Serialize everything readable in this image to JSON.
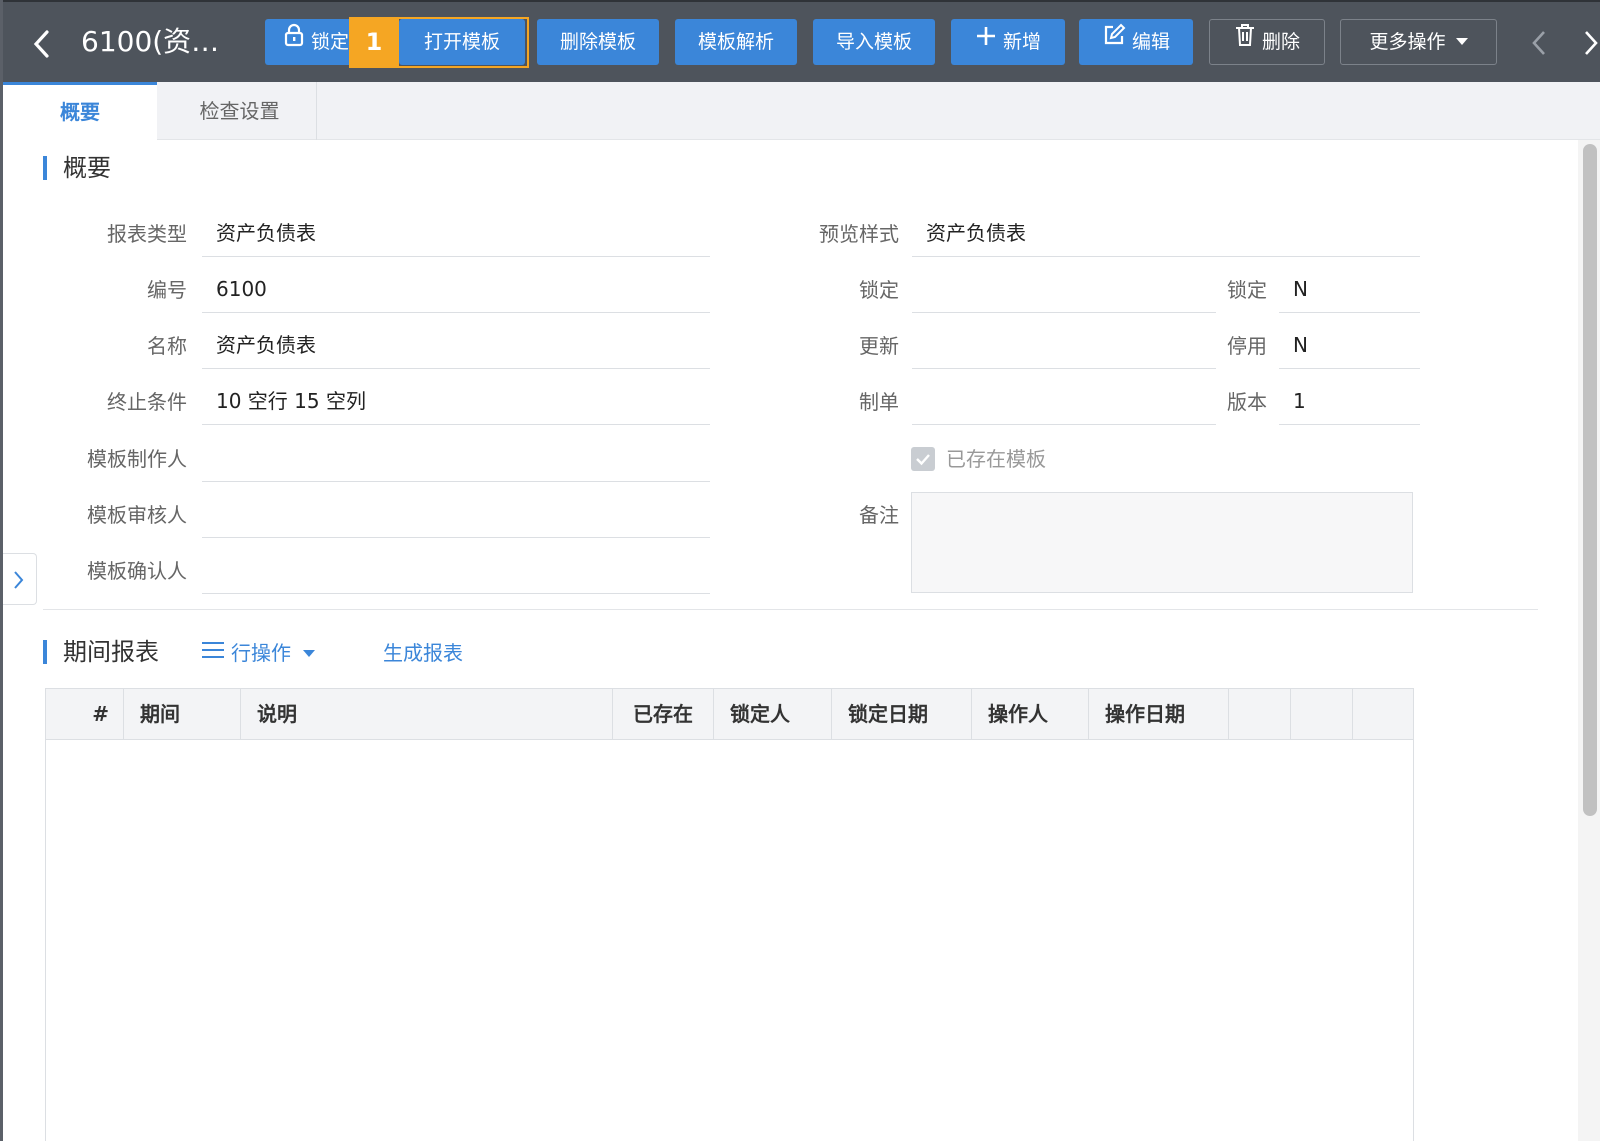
{
  "header": {
    "title": "6100(资…",
    "buttons": {
      "lock": "锁定",
      "open_template": "打开模板",
      "delete_template": "删除模板",
      "parse_template": "模板解析",
      "import_template": "导入模板",
      "add": "新增",
      "edit": "编辑",
      "delete": "删除",
      "more": "更多操作"
    },
    "marker_number": "1"
  },
  "tabs": [
    "概要",
    "检查设置"
  ],
  "overview": {
    "section_title": "概要",
    "left_fields": [
      {
        "label": "报表类型",
        "value": "资产负债表"
      },
      {
        "label": "编号",
        "value": "6100"
      },
      {
        "label": "名称",
        "value": "资产负债表"
      },
      {
        "label": "终止条件",
        "value": "10 空行 15 空列"
      },
      {
        "label": "模板制作人",
        "value": ""
      },
      {
        "label": "模板审核人",
        "value": ""
      },
      {
        "label": "模板确认人",
        "value": ""
      }
    ],
    "preview_style": {
      "label": "预览样式",
      "value": "资产负债表"
    },
    "mid_fields": [
      {
        "label": "锁定",
        "value": ""
      },
      {
        "label": "更新",
        "value": ""
      },
      {
        "label": "制单",
        "value": ""
      }
    ],
    "right_fields": [
      {
        "label": "锁定",
        "value": "N"
      },
      {
        "label": "停用",
        "value": "N"
      },
      {
        "label": "版本",
        "value": "1"
      }
    ],
    "template_exists": {
      "label": "已存在模板",
      "checked": true
    },
    "remarks": {
      "label": "备注",
      "value": ""
    }
  },
  "period_reports": {
    "section_title": "期间报表",
    "row_operation": "行操作",
    "generate_report": "生成报表",
    "columns": [
      "#",
      "期间",
      "说明",
      "已存在",
      "锁定人",
      "锁定日期",
      "操作人",
      "操作日期",
      "",
      "",
      ""
    ],
    "rows": []
  },
  "colors": {
    "toolbar_bg": "#4e545c",
    "primary": "#3b86d9",
    "marker": "#f5a623"
  }
}
